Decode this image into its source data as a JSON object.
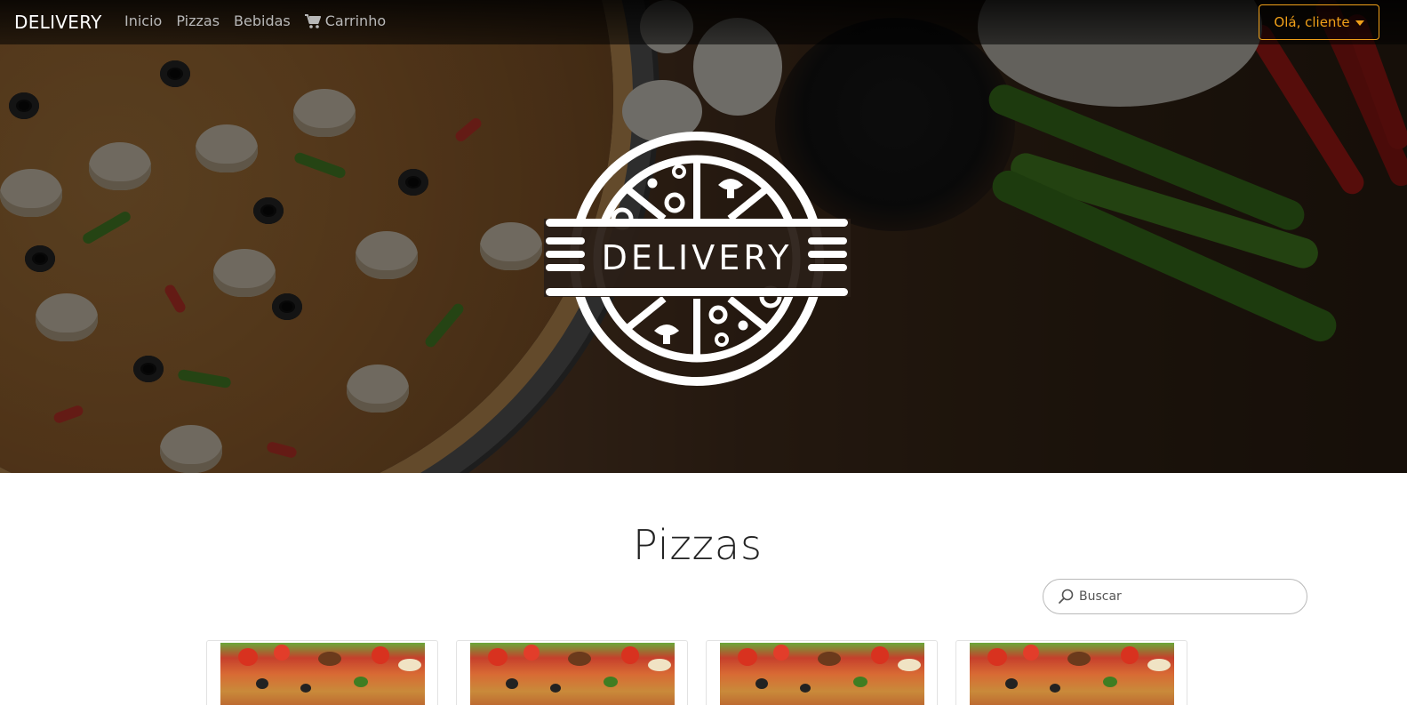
{
  "nav": {
    "brand": "DELIVERY",
    "links": [
      "Inicio",
      "Pizzas",
      "Bebidas",
      "Carrinho"
    ],
    "user_button": "Olá, cliente"
  },
  "hero": {
    "logo_text": "DELIVERY"
  },
  "main": {
    "title": "Pizzas",
    "search": {
      "placeholder": "Buscar",
      "value": ""
    },
    "cards_count_visible": 4
  },
  "colors": {
    "accent": "#f0a019",
    "nav_text": "#b8b8b8",
    "title_text": "#222222"
  },
  "icons": [
    "cart-icon",
    "chevron-down-icon",
    "search-icon"
  ]
}
